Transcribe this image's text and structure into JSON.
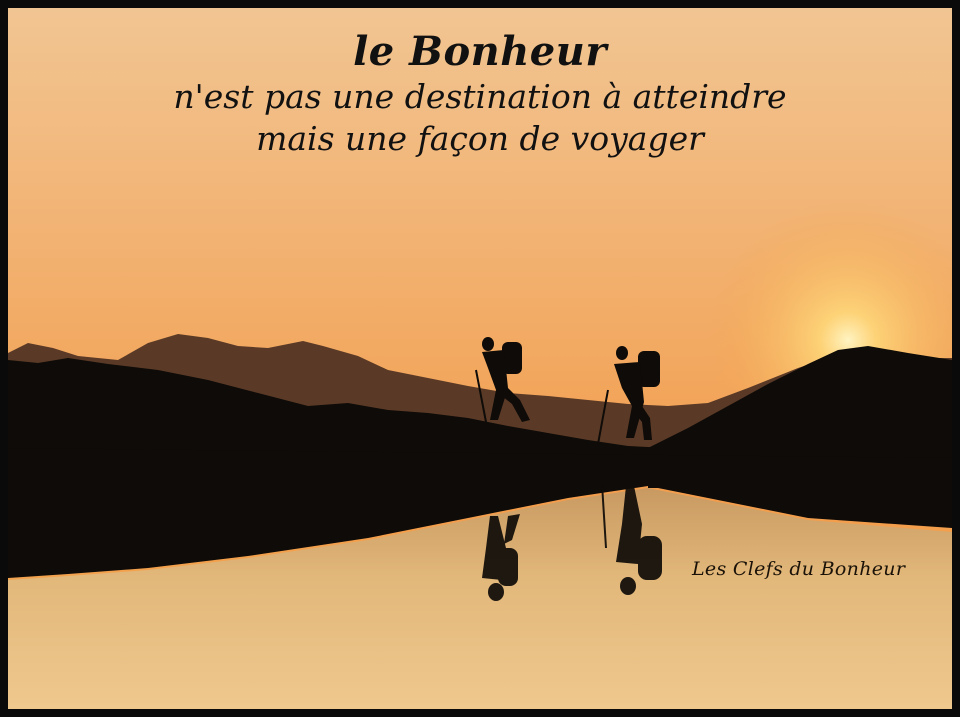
{
  "quote": {
    "title": "le Bonheur",
    "line1": "n'est pas une destination à atteindre",
    "line2": "mais une façon de voyager"
  },
  "signature": "Les Clefs du Bonheur",
  "colors": {
    "sky_top": "#f2c48a",
    "sky_mid": "#f3a45a",
    "sky_horizon": "#f4b24e",
    "sun": "#fff1b0",
    "silhouette": "#0e0b08",
    "distant_mountains": "#5c3a24",
    "water_top": "#d9b27a",
    "water_bottom": "#f0c98e",
    "frame": "#0a0a0a"
  }
}
